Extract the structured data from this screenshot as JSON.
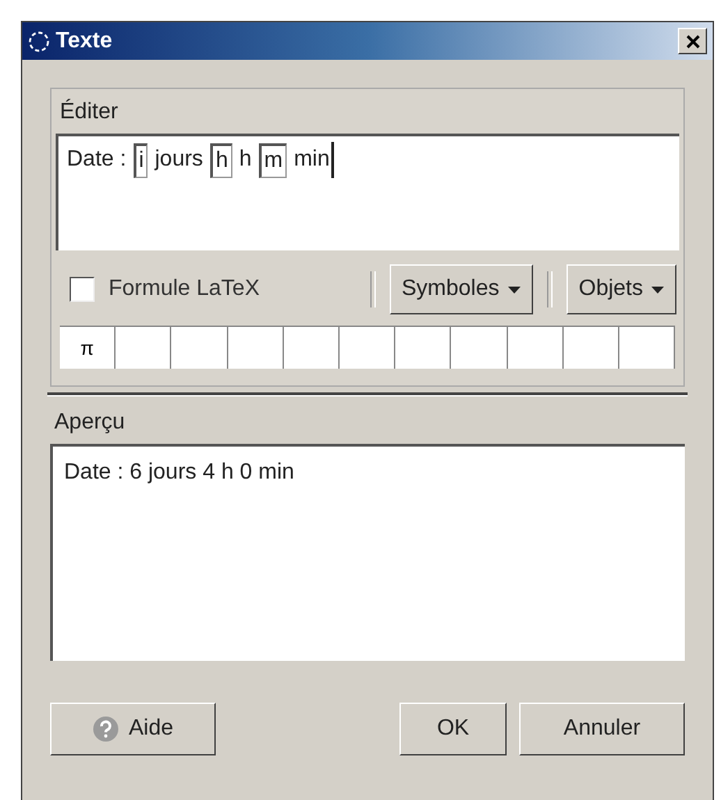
{
  "window": {
    "title": "Texte"
  },
  "edit": {
    "label": "Éditer",
    "segments": [
      {
        "kind": "text",
        "text": "Date :"
      },
      {
        "kind": "field",
        "text": "i"
      },
      {
        "kind": "text",
        "text": "jours"
      },
      {
        "kind": "field",
        "text": "h"
      },
      {
        "kind": "text",
        "text": "h"
      },
      {
        "kind": "field",
        "text": "m"
      },
      {
        "kind": "text",
        "text": "min"
      }
    ],
    "latex": {
      "label": "Formule LaTeX",
      "checked": false
    },
    "menus": [
      "Symboles",
      "Objets"
    ],
    "symbols": [
      "π"
    ]
  },
  "preview": {
    "label": "Aperçu",
    "text": "Date : 6 jours 4 h 0 min"
  },
  "buttons": {
    "help": "Aide",
    "ok": "OK",
    "cancel": "Annuler"
  }
}
